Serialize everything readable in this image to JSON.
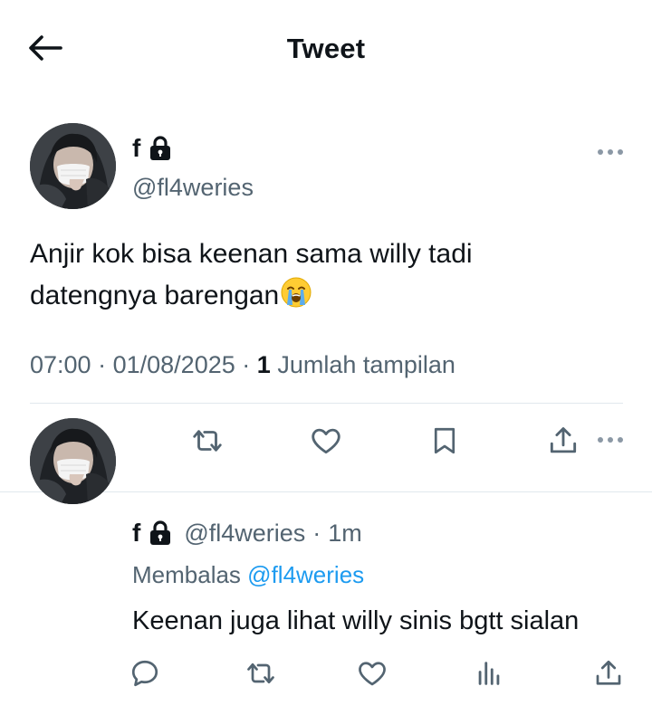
{
  "header": {
    "title": "Tweet"
  },
  "main_tweet": {
    "display_name": "f",
    "handle": "@fl4weries",
    "text_line1": "Anjir kok bisa keenan sama willy tadi",
    "text_line2": "datengnya barengan",
    "emoji": "loudly-crying-face",
    "time": "07:00",
    "date": "01/08/2025",
    "views_count": "1",
    "views_label": "Jumlah tampilan",
    "separator": "·"
  },
  "reply": {
    "display_name": "f",
    "handle": "@fl4weries",
    "separator": "·",
    "time": "1m",
    "replying_label": "Membalas",
    "replying_to": "@fl4weries",
    "text": "Keenan juga lihat willy sinis bgtt sialan"
  },
  "icons": {
    "back": "arrow-left-icon",
    "lock": "lock-icon",
    "more": "more-horizontal-icon",
    "reply": "reply-icon",
    "retweet": "retweet-icon",
    "like": "heart-icon",
    "bookmark": "bookmark-icon",
    "share": "share-icon",
    "views": "analytics-icon"
  },
  "colors": {
    "text": "#0f1419",
    "secondary": "#536471",
    "mention": "#1d9bf0",
    "divider": "#e1e8ed"
  }
}
